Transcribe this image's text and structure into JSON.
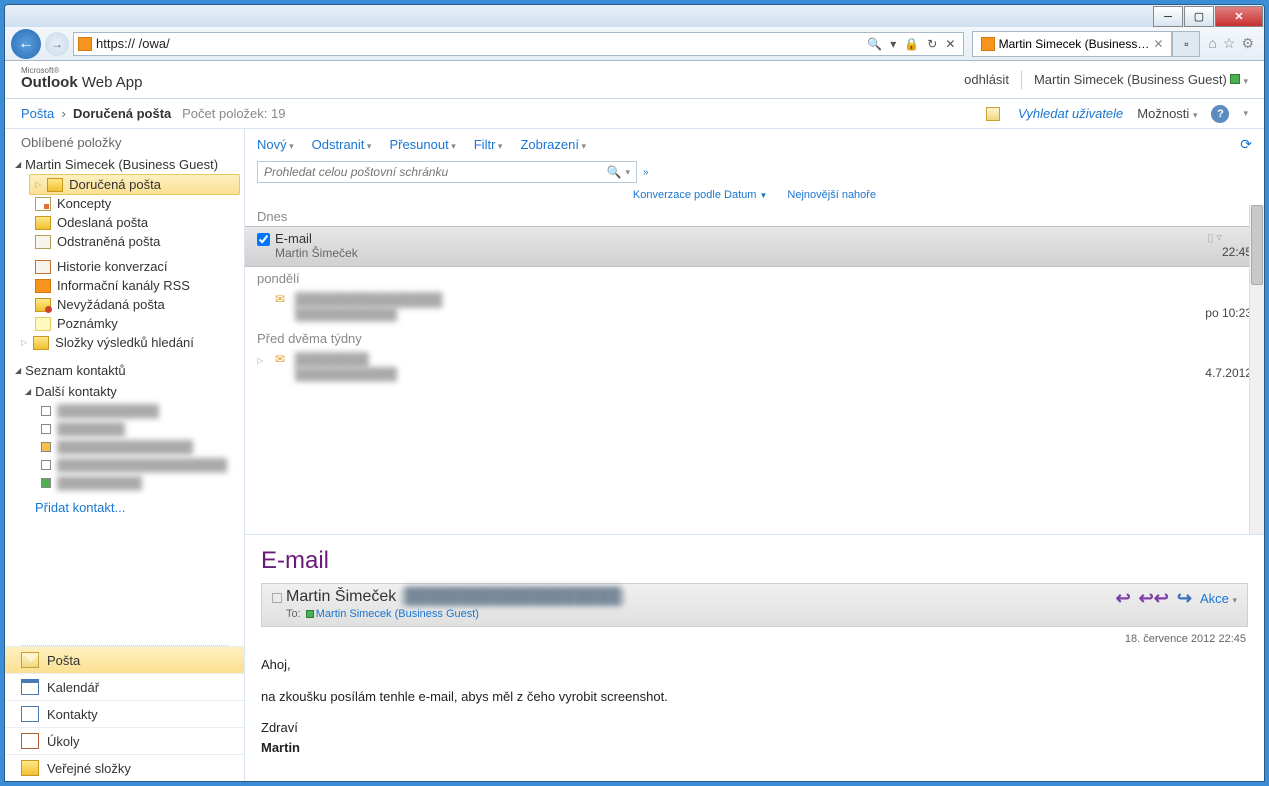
{
  "browser": {
    "url": "https://                               /owa/",
    "tab_title": "Martin Simecek (Business G...",
    "url_controls": {
      "search": "🔍",
      "lock": "🔒",
      "refresh": "↻",
      "stop": "✕"
    }
  },
  "owa": {
    "logo_small": "Microsoft®",
    "logo": "Outlook Web App",
    "signout": "odhlásit",
    "username": "Martin Simecek (Business Guest)"
  },
  "breadcrumb": {
    "root": "Pošta",
    "folder": "Doručená pošta",
    "count_label": "Počet položek: 19"
  },
  "topbar": {
    "search_people": "Vyhledat uživatele",
    "options": "Možnosti"
  },
  "sidebar": {
    "favorites": "Oblíbené položky",
    "account": "Martin Simecek (Business Guest)",
    "folders": {
      "inbox": "Doručená pošta",
      "drafts": "Koncepty",
      "sent": "Odeslaná pošta",
      "deleted": "Odstraněná pošta",
      "history": "Historie konverzací",
      "rss": "Informační kanály RSS",
      "junk": "Nevyžádaná pošta",
      "notes": "Poznámky",
      "search": "Složky výsledků hledání"
    },
    "contacts_hdr": "Seznam kontaktů",
    "other_contacts": "Další kontakty",
    "add_contact": "Přidat kontakt...",
    "nav": {
      "mail": "Pošta",
      "calendar": "Kalendář",
      "contacts": "Kontakty",
      "tasks": "Úkoly",
      "public": "Veřejné složky"
    }
  },
  "toolbar": {
    "new": "Nový",
    "delete": "Odstranit",
    "move": "Přesunout",
    "filter": "Filtr",
    "view": "Zobrazení"
  },
  "search": {
    "placeholder": "Prohledat celou poštovní schránku"
  },
  "listmeta": {
    "sort": "Konverzace podle Datum",
    "order": "Nejnovější nahoře"
  },
  "groups": {
    "today": "Dnes",
    "monday": "pondělí",
    "twoweeks": "Před dvěma týdny"
  },
  "messages": {
    "m1": {
      "subject": "E-mail",
      "from": "Martin Šimeček",
      "time": "22:45"
    },
    "m2": {
      "subject": "████████████████",
      "from": "████████████",
      "time": "po 10:23"
    },
    "m3": {
      "subject": "████████",
      "from": "████████████",
      "time": "4.7.2012"
    }
  },
  "reading": {
    "subject": "E-mail",
    "from_name": "Martin Šimeček",
    "from_email": "[███████████████████]",
    "to_label": "To:",
    "to_name": "Martin Simecek (Business Guest)",
    "actions_label": "Akce",
    "date": "18. července 2012 22:45",
    "body": {
      "greet": "Ahoj,",
      "line1": "na zkoušku posílám tenhle e-mail, abys měl z čeho vyrobit screenshot.",
      "sig1": "Zdraví",
      "sig2": "Martin"
    }
  }
}
